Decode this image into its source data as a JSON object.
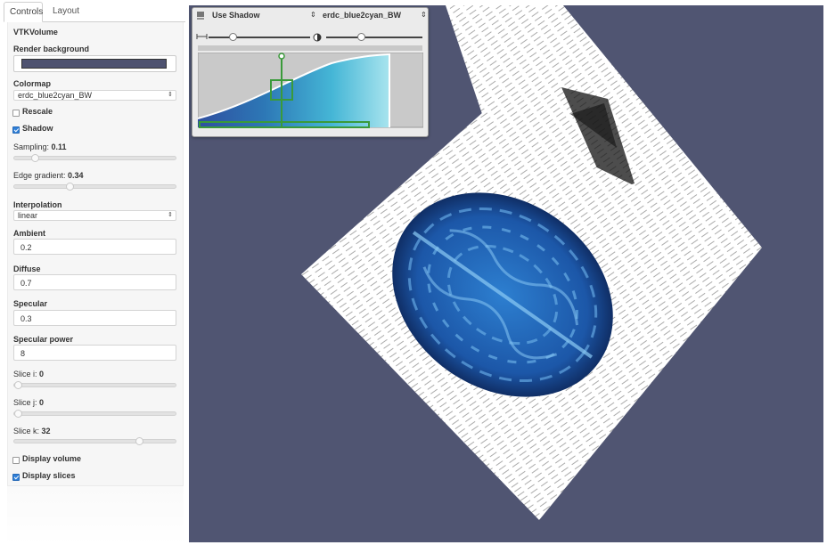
{
  "tabs": [
    {
      "label": "Controls",
      "active": true
    },
    {
      "label": "Layout",
      "active": false
    }
  ],
  "panel": {
    "title": "VTKVolume",
    "render_background": {
      "label": "Render background",
      "color": "#4e5270"
    },
    "colormap": {
      "label": "Colormap",
      "value": "erdc_blue2cyan_BW"
    },
    "rescale": {
      "label": "Rescale",
      "checked": false
    },
    "shadow": {
      "label": "Shadow",
      "checked": true
    },
    "sampling": {
      "label": "Sampling: ",
      "value": "0.11",
      "level": 0.11
    },
    "edge_gradient": {
      "label": "Edge gradient: ",
      "value": "0.34",
      "level": 0.34
    },
    "interpolation": {
      "label": "Interpolation",
      "value": "linear"
    },
    "ambient": {
      "label": "Ambient",
      "value": "0.2"
    },
    "diffuse": {
      "label": "Diffuse",
      "value": "0.7"
    },
    "specular": {
      "label": "Specular",
      "value": "0.3"
    },
    "specular_power": {
      "label": "Specular power",
      "value": "8"
    },
    "slice_i": {
      "label": "Slice i: ",
      "value": "0",
      "level": 0
    },
    "slice_j": {
      "label": "Slice j: ",
      "value": "0",
      "level": 0
    },
    "slice_k": {
      "label": "Slice k: ",
      "value": "32",
      "level": 0.79
    },
    "display_volume": {
      "label": "Display volume",
      "checked": false
    },
    "display_slices": {
      "label": "Display slices",
      "checked": true
    }
  },
  "tf_widget": {
    "shadow_select": "Use Shadow",
    "preset_select": "erdc_blue2cyan_BW",
    "range_a_level": 0.22,
    "range_b_level": 0.35,
    "accent_color": "#3a9a3a"
  },
  "view": {
    "background": "#505572"
  },
  "icons": {
    "select_arrows": "⇕",
    "shadow_toggle_icon": "shadow-icon",
    "spacing_icon": "spacing-icon"
  }
}
